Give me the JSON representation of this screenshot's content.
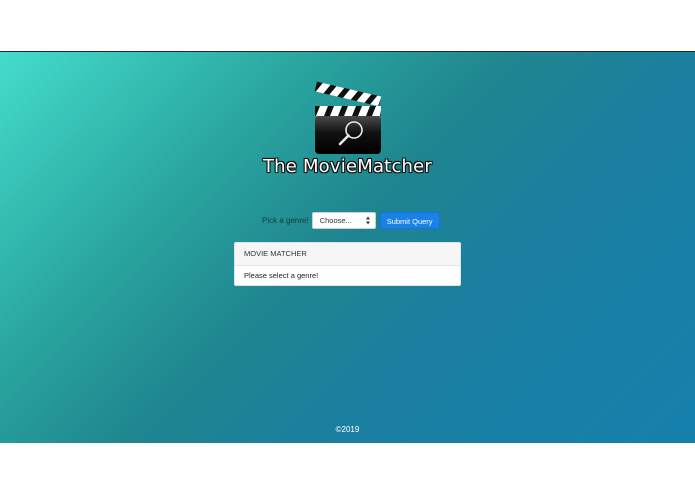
{
  "header": {
    "title": "The MovieMatcher"
  },
  "logo": {
    "icon": "clapperboard-magnifier-icon"
  },
  "form": {
    "genre_label": "Pick a genre!",
    "genre_select_value": "Choose...",
    "submit_label": "Submit Query"
  },
  "result_card": {
    "header": "MOVIE MATCHER",
    "message": "Please select a genre!"
  },
  "footer": {
    "copyright": "©2019"
  },
  "colors": {
    "gradient_start": "#44dccb",
    "gradient_end": "#1680ad",
    "button": "#1a82e6"
  }
}
